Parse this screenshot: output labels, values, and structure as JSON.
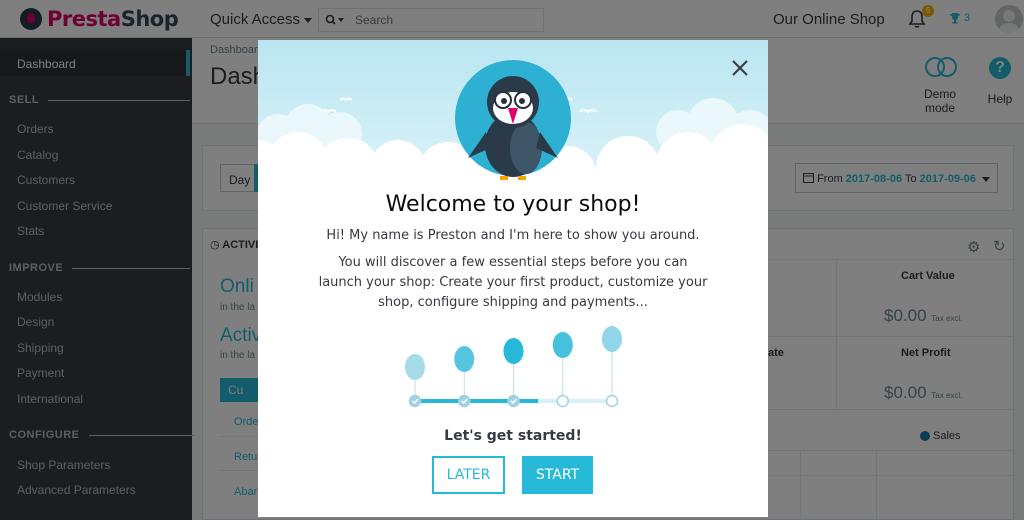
{
  "header": {
    "logo_prefix": "Presta",
    "logo_suffix": "Shop",
    "quick_access": "Quick Access",
    "search_placeholder": "Search",
    "shop_name": "Our Online Shop",
    "notifications_count": "6",
    "trophy_count": "3"
  },
  "sidebar": {
    "dashboard": "Dashboard",
    "sections": [
      {
        "title": "SELL",
        "items": [
          "Orders",
          "Catalog",
          "Customers",
          "Customer Service",
          "Stats"
        ]
      },
      {
        "title": "IMPROVE",
        "items": [
          "Modules",
          "Design",
          "Shipping",
          "Payment",
          "International"
        ]
      },
      {
        "title": "CONFIGURE",
        "items": [
          "Shop Parameters",
          "Advanced Parameters"
        ]
      }
    ]
  },
  "page": {
    "breadcrumb": "Dashboard",
    "title": "Dashboard",
    "demo_mode": "Demo mode",
    "help": "Help",
    "day": "Day",
    "date_from_label": "From",
    "date_from": "2017-08-06",
    "date_to_label": "To",
    "date_to": "2017-09-06",
    "activity_title": "ACTIVITY",
    "online_label": "Onli",
    "online_sub": "in the la",
    "active_label": "Activ",
    "active_sub": "in the la",
    "tab_label": "Cu",
    "rows": [
      "Orde",
      "Retu",
      "Aban"
    ],
    "kpis": [
      {
        "title": "Cart Value",
        "value": "$0.00",
        "unit": "Tax excl."
      },
      {
        "title": "Net Profit",
        "value": "$0.00",
        "unit": "Tax excl."
      }
    ],
    "rate_fragment": "ate",
    "sales_legend": "Sales"
  },
  "modal": {
    "title": "Welcome to your shop!",
    "intro": "Hi! My name is Preston and I'm here to show you around.",
    "body": "You will discover a few essential steps before you can launch your shop: Create your first product, customize your shop, configure shipping and payments...",
    "cta_heading": "Let's get started!",
    "later_button": "LATER",
    "start_button": "START",
    "steps_total": 5,
    "steps_completed": 3
  },
  "colors": {
    "accent": "#25b9d7",
    "brand_pink": "#df0067",
    "sidebar_bg": "#363a41"
  }
}
